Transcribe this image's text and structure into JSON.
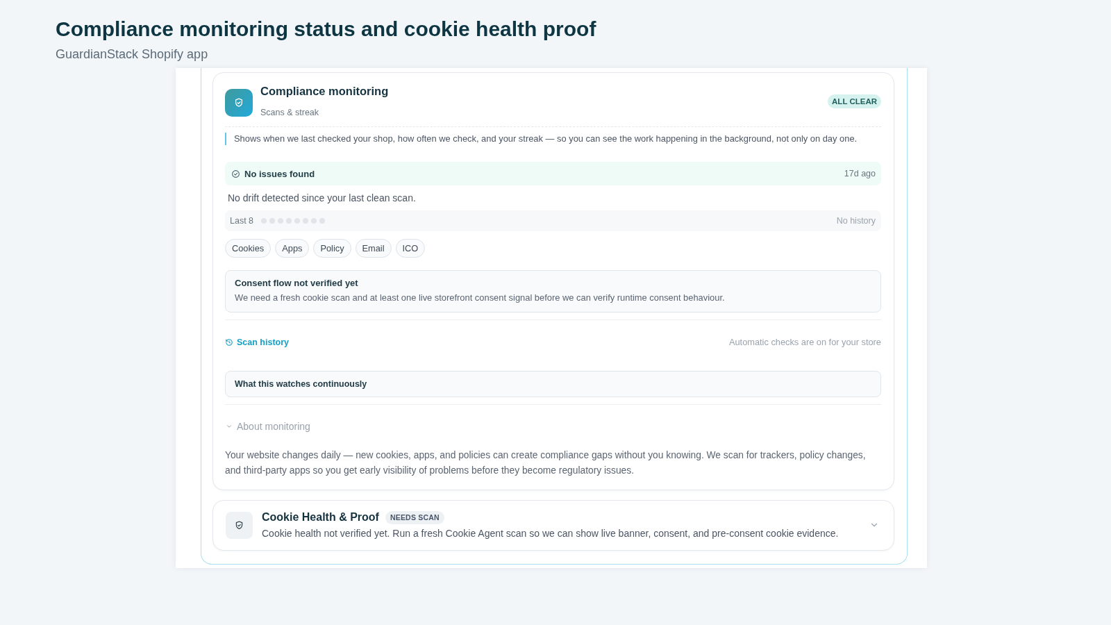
{
  "page": {
    "title": "Compliance monitoring status and cookie health proof",
    "subtitle": "GuardianStack Shopify app"
  },
  "monitoring_card": {
    "title": "Compliance monitoring",
    "subtitle": "Scans & streak",
    "badge": {
      "text": "ALL CLEAR",
      "kind": "success"
    },
    "note": "Shows when we last checked your shop, how often we check, and your streak — so you can see the work happening in the background, not only on day one.",
    "status": {
      "label": "No issues found",
      "time": "17d ago"
    },
    "summary": "No drift detected since your last clean scan.",
    "history": {
      "label": "Last 8",
      "dots": [
        {
          "filled": false
        },
        {
          "filled": false
        },
        {
          "filled": false
        },
        {
          "filled": false
        },
        {
          "filled": false
        },
        {
          "filled": false
        },
        {
          "filled": false
        },
        {
          "filled": false
        }
      ],
      "empty_text": "No history"
    },
    "tags": [
      "Cookies",
      "Apps",
      "Policy",
      "Email",
      "ICO"
    ],
    "notice": {
      "title": "Consent flow not verified yet",
      "text": "We need a fresh cookie scan and at least one live storefront consent signal before we can verify runtime consent behaviour."
    },
    "footer": {
      "link": "Scan history",
      "text": "Automatic checks are on for your store"
    },
    "watch_panel": {
      "title": "What this watches continuously"
    },
    "about": {
      "label": "About monitoring",
      "expanded": true,
      "text": "Your website changes daily — new cookies, apps, and policies can create compliance gaps without you knowing. We scan for trackers, policy changes, and third-party apps so you get early visibility of problems before they become regulatory issues."
    }
  },
  "cookie_health_card": {
    "title": "Cookie Health & Proof",
    "badge": {
      "text": "NEEDS SCAN",
      "kind": "neutral"
    },
    "description": "Cookie health not verified yet. Run a fresh Cookie Agent scan so we can show live banner, consent, and pre-consent cookie evidence.",
    "expanded": false
  }
}
